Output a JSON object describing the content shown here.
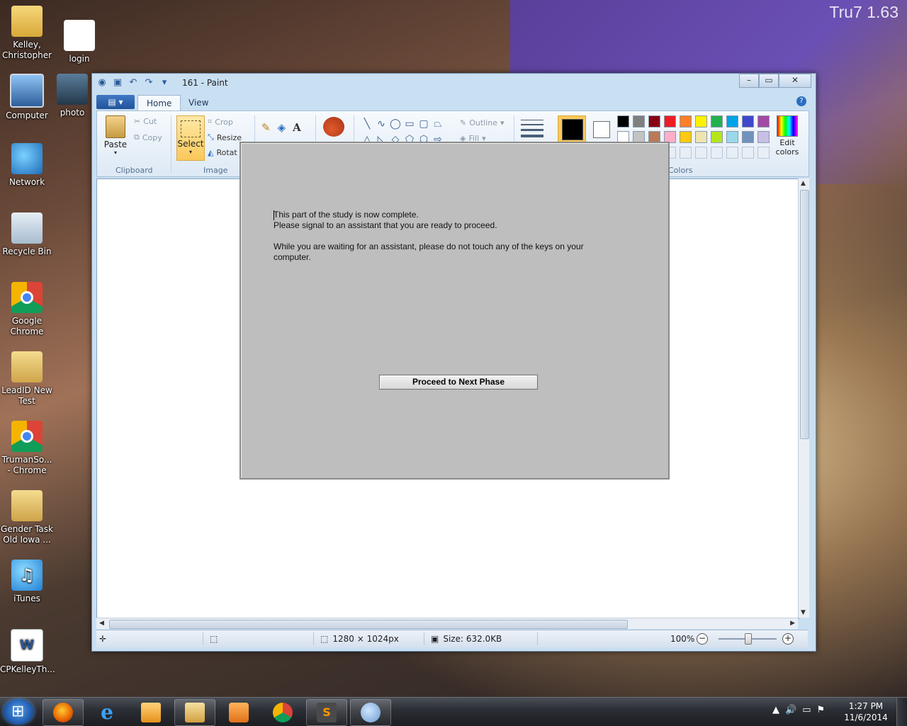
{
  "desktop": {
    "version_label": "Tru7 1.63",
    "icons": [
      {
        "label": "Kelley,\nChristopher",
        "icon": "folder-user-icon"
      },
      {
        "label": "login",
        "icon": "file-icon"
      },
      {
        "label": "Computer",
        "icon": "computer-icon"
      },
      {
        "label": "photo",
        "icon": "photo-icon"
      },
      {
        "label": "Network",
        "icon": "network-icon"
      },
      {
        "label": "Recycle Bin",
        "icon": "recycle-bin-icon"
      },
      {
        "label": "Google\nChrome",
        "icon": "chrome-icon"
      },
      {
        "label": "LeadID New\nTest",
        "icon": "folder-icon"
      },
      {
        "label": "TrumanSo...\n- Chrome",
        "icon": "chrome-icon"
      },
      {
        "label": "Gender Task\nOld Iowa ...",
        "icon": "folder-icon"
      },
      {
        "label": "iTunes",
        "icon": "itunes-icon"
      },
      {
        "label": "CPKelleyTh...",
        "icon": "word-doc-icon"
      }
    ]
  },
  "paint": {
    "title": "161 - Paint",
    "tabs": [
      "Home",
      "View"
    ],
    "clipboard": {
      "paste": "Paste",
      "cut": "Cut",
      "copy": "Copy",
      "group": "Clipboard"
    },
    "image": {
      "select": "Select",
      "crop": "Crop",
      "resize": "Resize",
      "rotate": "Rotat",
      "group": "Image"
    },
    "shapes": {
      "outline": "Outline",
      "fill": "Fill"
    },
    "colors": {
      "group": "Colors",
      "edit": "Edit\ncolors",
      "color1": "#000000",
      "color2": "#ffffff",
      "row1": [
        "#000000",
        "#7f7f7f",
        "#880015",
        "#ed1c24",
        "#ff7f27",
        "#fff200",
        "#22b14c",
        "#00a2e8",
        "#3f48cc",
        "#a349a4"
      ],
      "row2": [
        "#ffffff",
        "#c3c3c3",
        "#b97a57",
        "#ffaec9",
        "#ffc90e",
        "#efe4b0",
        "#b5e61d",
        "#99d9ea",
        "#7092be",
        "#c8bfe7"
      ]
    },
    "status": {
      "dimensions": "1280 × 1024px",
      "size": "Size: 632.0KB",
      "zoom": "100%"
    }
  },
  "dialog": {
    "line1": "This part of the study is now complete.",
    "line2": "Please signal to an assistant that you are ready to proceed.",
    "line3": "While you are waiting for an assistant, please do not touch any of the keys on your",
    "line4": "computer.",
    "button": "Proceed to Next Phase"
  },
  "taskbar": {
    "apps": [
      "firefox-icon",
      "internet-explorer-icon",
      "outlook-icon",
      "file-explorer-icon",
      "media-player-icon",
      "chrome-icon",
      "sublime-text-icon",
      "paint-icon"
    ],
    "time": "1:27 PM",
    "date": "11/6/2014"
  }
}
